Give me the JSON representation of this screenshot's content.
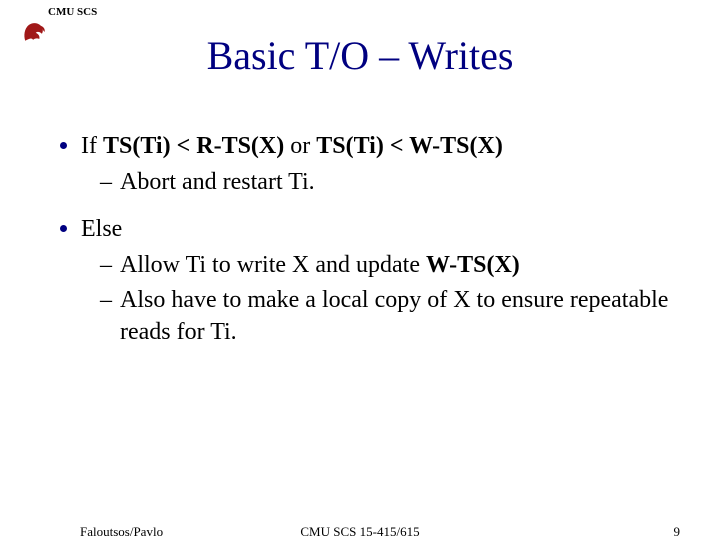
{
  "header": {
    "label": "CMU SCS"
  },
  "title": "Basic T/O – Writes",
  "bullets": [
    {
      "prefix": "If ",
      "bold1": "TS(Ti) < R-TS(X)",
      "mid": " or ",
      "bold2": "TS(Ti) < W-TS(X)",
      "subs": [
        "Abort and restart Ti."
      ]
    },
    {
      "prefix": "Else",
      "subs": [
        {
          "pre": "Allow Ti to write X and update ",
          "bold": "W-TS(X)"
        },
        {
          "text": "Also have to make a local copy of X to ensure repeatable reads for Ti."
        }
      ]
    }
  ],
  "footer": {
    "left": "Faloutsos/Pavlo",
    "center": "CMU SCS 15-415/615",
    "right": "9"
  }
}
